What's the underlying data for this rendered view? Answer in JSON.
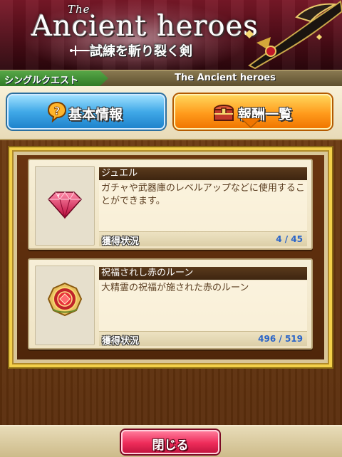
{
  "banner": {
    "title_the": "The",
    "title_main": "Ancient heroes",
    "title_sub": "試練を斬り裂く剣"
  },
  "subheader": {
    "crumb": "シングルクエスト",
    "title": "The Ancient heroes"
  },
  "tabs": [
    {
      "label": "基本情報",
      "icon": "question-icon",
      "active": false
    },
    {
      "label": "報酬一覧",
      "icon": "treasure-chest-icon",
      "active": true
    }
  ],
  "rewards": [
    {
      "name": "ジュエル",
      "description": "ガチャや武器庫のレベルアップなどに使用することができます。",
      "status_label": "獲得状況",
      "status_value": "4 / 45",
      "icon": "jewel-icon"
    },
    {
      "name": "祝福されし赤のルーン",
      "description": "大精霊の祝福が施された赤のルーン",
      "status_label": "獲得状況",
      "status_value": "496 / 519",
      "icon": "red-rune-icon"
    }
  ],
  "footer": {
    "close_label": "閉じる"
  },
  "colors": {
    "active_tab": "#ff9b1c",
    "inactive_tab": "#41a9e8",
    "close_button": "#ee2c5a",
    "status_value": "#2a64c8",
    "frame_gold": "#f3d04a"
  }
}
